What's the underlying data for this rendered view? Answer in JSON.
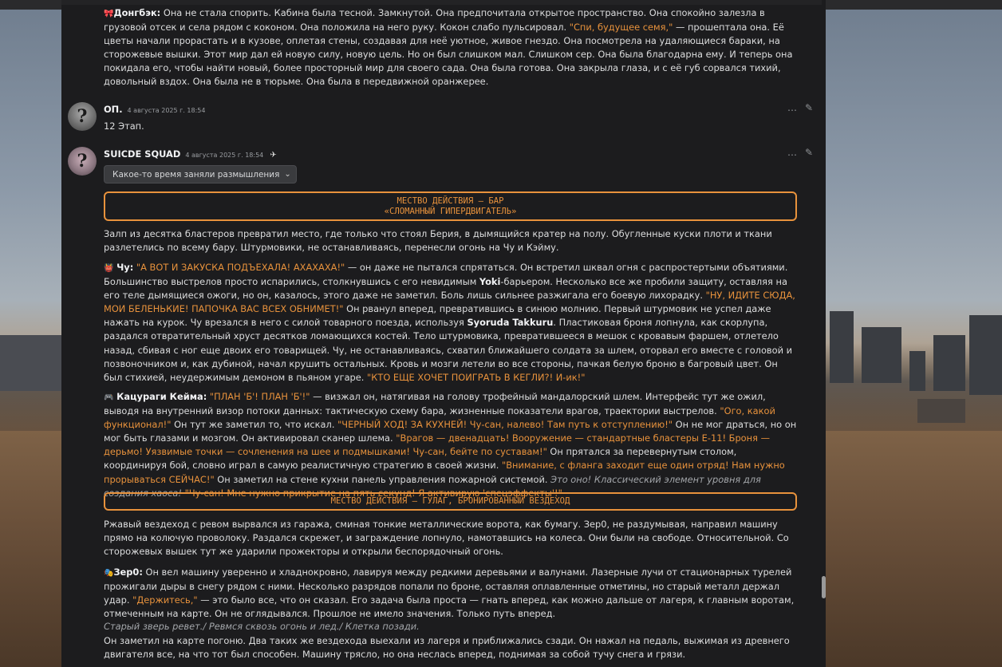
{
  "messages": {
    "top": {
      "speaker_emoji": "🎀",
      "speaker": "Донгбэк:",
      "t1": " Она не стала спорить. Кабина была тесной. Замкнутой. Она предпочитала открытое пространство. Она спокойно залезла в грузовой отсек и села рядом с коконом. Она положила на него руку. Кокон слабо пульсировал. ",
      "q1": "\"Спи, будущее семя,\"",
      "t2": " — прошептала она. Её цветы начали прорастать и в кузове, оплетая стены, создавая для неё уютное, живое гнездо. Она посмотрела на удаляющиеся бараки, на сторожевые вышки. Этот мир дал ей новую силу, новую цель. Но он был слишком мал. Слишком сер. Она была благодарна ему. И теперь она покидала его, чтобы найти новый, более просторный мир для своего сада. Она была готова. Она закрыла глаза, и с её губ сорвался тихий, довольный вздох. Она была не в тюрьме. Она была в передвижной оранжерее."
    },
    "op": {
      "author": "ОП.",
      "timestamp": "4 августа 2025 г. 18:54",
      "text": "12 Этап."
    },
    "squad": {
      "author": "SUICDE SQUAD",
      "timestamp": "4 августа 2025 г. 18:54",
      "dropdown_label": "Какое-то время заняли размышления",
      "location1_line1": "МЕСТВО ДЕЙСТВИЯ – БАР",
      "location1_line2": "«СЛОМАННЫЙ ГИПЕРДВИГАТЕЛЬ»",
      "p1": "Залп из десятка бластеров превратил место, где только что стоял Берия, в дымящийся кратер на полу. Обугленные куски плоти и ткани разлетелись по всему бару. Штурмовики, не останавливаясь, перенесли огонь на Чу и Кэйму.",
      "chu": {
        "emoji": "👹",
        "name": "Чу:",
        "q1": "\"А ВОТ И ЗАКУСКА ПОДЪЕХАЛА! АХАХАХА!\"",
        "t1": " — он даже не пытался спрятаться. Он встретил шквал огня с распростертыми объятиями. Большинство выстрелов просто испарились, столкнувшись с его невидимым ",
        "b1": "Yoki",
        "t2": "-барьером. Несколько все же пробили защиту, оставляя на его теле дымящиеся ожоги, но он, казалось, этого даже не заметил. Боль лишь сильнее разжигала его боевую лихорадку. ",
        "q2": "\"НУ, ИДИТЕ СЮДА, МОИ БЕЛЕНЬКИЕ! ПАПОЧКА ВАС ВСЕХ ОБНИМЕТ!\"",
        "t3": " Он рванул вперед, превратившись в синюю молнию. Первый штурмовик не успел даже нажать на курок. Чу врезался в него с силой товарного поезда, используя ",
        "b2": "Syoruda Takkuru",
        "t4": ". Пластиковая броня лопнула, как скорлупа, раздался отвратительный хруст десятков ломающихся костей. Тело штурмовика, превратившееся в мешок с кровавым фаршем, отлетело назад, сбивая с ног еще двоих его товарищей. Чу, не останавливаясь, схватил ближайшего солдата за шлем, оторвал его вместе с головой и позвоночником и, как дубиной, начал крушить остальных. Кровь и мозги летели во все стороны, пачкая белую броню в багровый цвет. Он был стихией, неудержимым демоном в пьяном угаре. ",
        "q3": "\"КТО ЕЩЕ ХОЧЕТ ПОИГРАТЬ В КЕГЛИ?! И-ик!\""
      },
      "keima": {
        "emoji": "🎮",
        "name": "Кацураги Кейма:",
        "q1": " \"ПЛАН 'Б'! ПЛАН 'Б'!\"",
        "t1": " — визжал он, натягивая на голову трофейный мандалорский шлем. Интерфейс тут же ожил, выводя на внутренний визор потоки данных: тактическую схему бара, жизненные показатели врагов, траектории выстрелов. ",
        "q2": "\"Ого, какой функционал!\"",
        "t2": " Он тут же заметил то, что искал. ",
        "q3": "\"ЧЕРНЫЙ ХОД! ЗА КУХНЕЙ! Чу-сан, налево! Там путь к отступлению!\"",
        "t3": " Он не мог драться, но он мог быть глазами и мозгом. Он активировал сканер шлема. ",
        "q4": "\"Врагов — двенадцать! Вооружение — стандартные бластеры Е-11! Броня — дерьмо! Уязвимые точки — сочленения на шее и подмышками! Чу-сан, бейте по суставам!\"",
        "t4": " Он прятался за перевернутым столом, координируя бой, словно играл в самую реалистичную стратегию в своей жизни. ",
        "q5": "\"Внимание, с фланга заходит еще один отряд! Нам нужно прорываться СЕЙЧАС!\"",
        "t5": " Он заметил на стене кухни панель управления пожарной системой. ",
        "em1": "Это оно! Классический элемент уровня для создания хаоса!",
        "q6": " \"Чу-сан! Мне нужно прикрытие на пять секунд! Я активирую 'спецэффекты'!\""
      },
      "location2": "МЕСТВО ДЕЙСТВИЯ – ГУЛАГ, БРОНИРОВАННЫЙ ВЕЗДЕХОД",
      "p2": "Ржавый вездеход с ревом вырвался из гаража, сминая тонкие металлические ворота, как бумагу. Зер0, не раздумывая, направил машину прямо на колючую проволоку. Раздался скрежет, и заграждение лопнуло, намотавшись на колеса. Они были на свободе. Относительной. Со сторожевых вышек тут же ударили прожекторы и открыли беспорядочный огонь.",
      "zero": {
        "emoji": "🎭",
        "name": "Зер0:",
        "t1": " Он вел машину уверенно и хладнокровно, лавируя между редкими деревьями и валунами. Лазерные лучи от стационарных турелей прожигали дыры в снегу рядом с ними. Несколько разрядов попали по броне, оставляя оплавленные отметины, но старый металл держал удар. ",
        "q1": "\"Держитесь,\"",
        "t2": " — это было все, что он сказал. Его задача была проста — гнать вперед, как можно дальше от лагеря, к главным воротам, отмеченным на карте. Он не оглядывался. Прошлое не имело значения. Только путь вперед.",
        "em1": "Старый зверь ревет./ Ревмся сквозь огонь и лед./ Клетка позади.",
        "t3": "Он заметил на карте погоню. Два таких же вездехода выехали из лагеря и приближались сзади. Он нажал на педаль, выжимая из древнего двигателя все, на что тот был способен. Машину трясло, но она неслась вперед, поднимая за собой тучу снега и грязи."
      }
    }
  },
  "icons": {
    "more": "…",
    "edit": "✎",
    "bot": "✈",
    "chevron": "⌄",
    "avatar_glyph": "?"
  },
  "colors": {
    "accent": "#e8923c",
    "panel": "#1c1c1e",
    "text": "#dcddde"
  }
}
